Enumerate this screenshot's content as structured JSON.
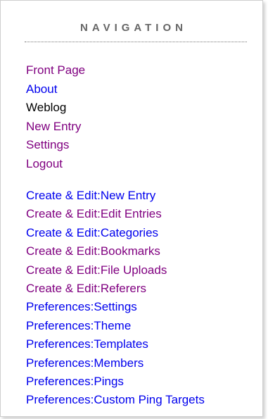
{
  "navigation": {
    "title": "NAVIGATION",
    "primary_links": [
      {
        "label": "Front Page",
        "color": "#800080"
      },
      {
        "label": "About",
        "color": "#0000ee"
      },
      {
        "label": "Weblog",
        "color": "#000000"
      },
      {
        "label": "New Entry",
        "color": "#800080"
      },
      {
        "label": "Settings",
        "color": "#800080"
      },
      {
        "label": "Logout",
        "color": "#800080"
      }
    ],
    "secondary_links": [
      {
        "label": "Create & Edit:New Entry",
        "color": "#0000ee"
      },
      {
        "label": "Create & Edit:Edit Entries",
        "color": "#800080"
      },
      {
        "label": "Create & Edit:Categories",
        "color": "#0000ee"
      },
      {
        "label": "Create & Edit:Bookmarks",
        "color": "#800080"
      },
      {
        "label": "Create & Edit:File Uploads",
        "color": "#800080"
      },
      {
        "label": "Create & Edit:Referers",
        "color": "#800080"
      },
      {
        "label": "Preferences:Settings",
        "color": "#0000ee"
      },
      {
        "label": "Preferences:Theme",
        "color": "#0000ee"
      },
      {
        "label": "Preferences:Templates",
        "color": "#0000ee"
      },
      {
        "label": "Preferences:Members",
        "color": "#0000ee"
      },
      {
        "label": "Preferences:Pings",
        "color": "#0000ee"
      },
      {
        "label": "Preferences:Custom Ping Targets",
        "color": "#0000ee"
      }
    ]
  }
}
